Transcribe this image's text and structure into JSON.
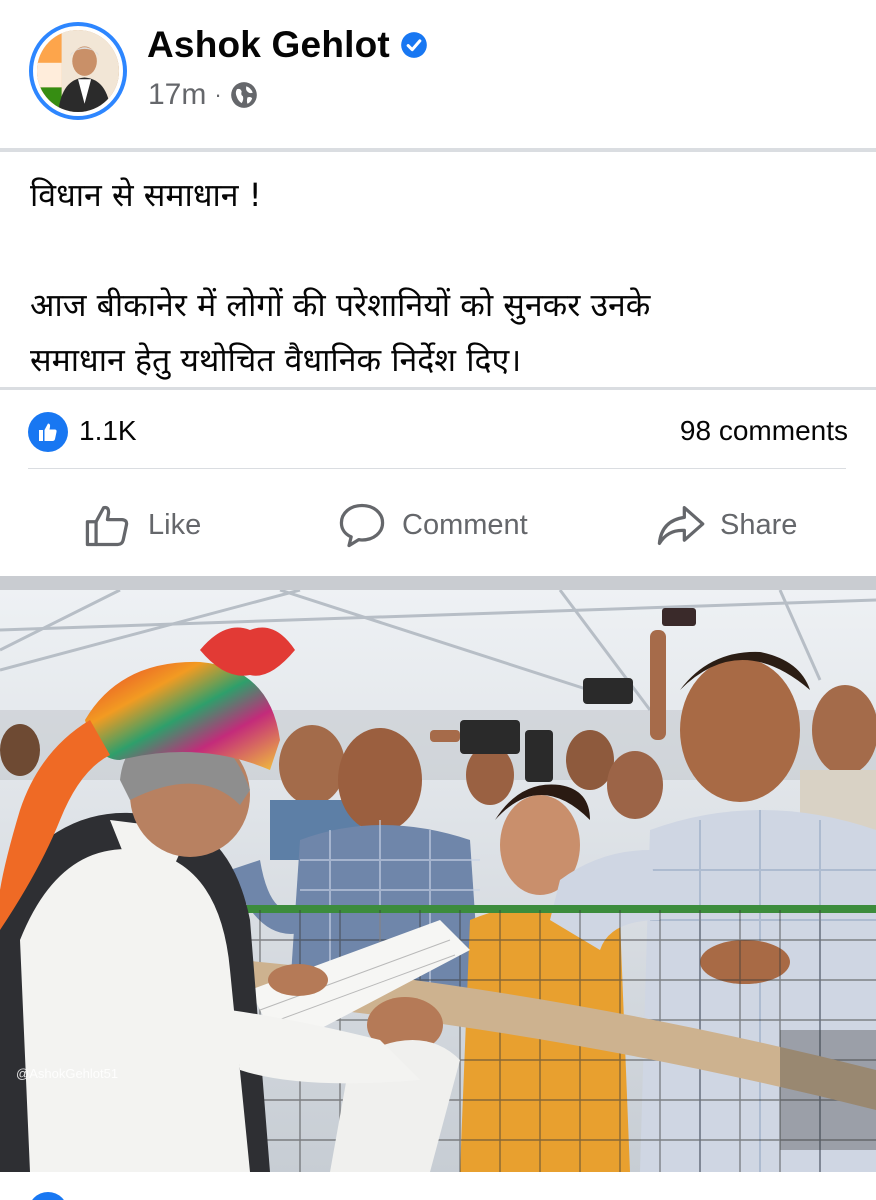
{
  "post": {
    "author": "Ashok Gehlot",
    "time": "17m",
    "separator": "·",
    "text_line1": "विधान से समाधान !",
    "text_line2": "आज बीकानेर में लोगों की परेशानियों को सुनकर उनके",
    "text_line3": "समाधान हेतु यथोचित वैधानिक निर्देश दिए।"
  },
  "stats": {
    "reactions": "1.1K",
    "comments": "98 comments"
  },
  "actions": {
    "like": "Like",
    "comment": "Comment",
    "share": "Share"
  },
  "photo": {
    "watermark": "@AshokGehlot51"
  },
  "colors": {
    "brand_blue": "#1877f2",
    "secondary_text": "#65676b",
    "divider": "#dadde1"
  },
  "icons": [
    "verified-badge-icon",
    "globe-icon",
    "like-reaction-icon",
    "thumbs-up-icon",
    "comment-bubble-icon",
    "share-arrow-icon"
  ]
}
